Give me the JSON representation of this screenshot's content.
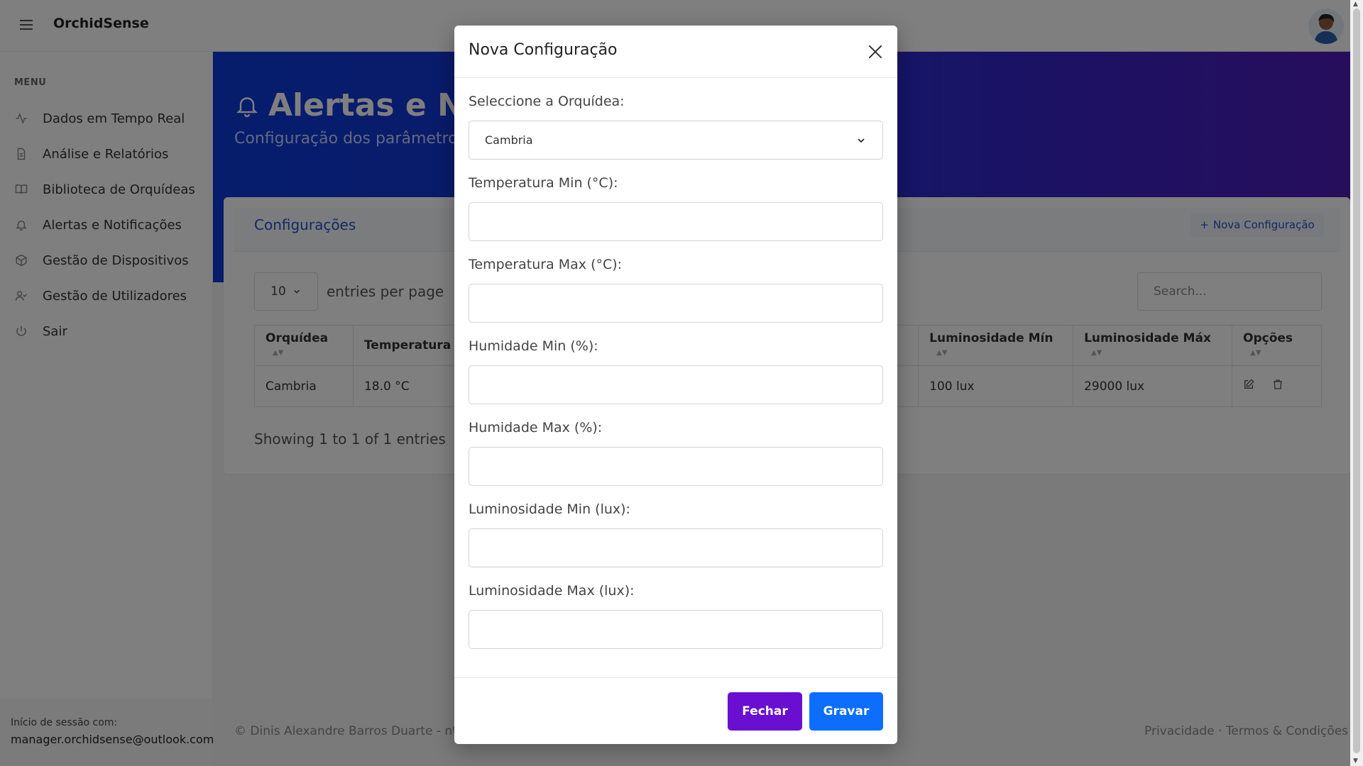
{
  "app": {
    "brand": "OrchidSense"
  },
  "sidebar": {
    "menu_title": "MENU",
    "items": [
      {
        "label": "Dados em Tempo Real",
        "icon": "activity-icon"
      },
      {
        "label": "Análise e Relatórios",
        "icon": "file-text-icon"
      },
      {
        "label": "Biblioteca de Orquídeas",
        "icon": "book-open-icon"
      },
      {
        "label": "Alertas e Notificações",
        "icon": "bell-icon"
      },
      {
        "label": "Gestão de Dispositivos",
        "icon": "box-icon"
      },
      {
        "label": "Gestão de Utilizadores",
        "icon": "user-check-icon"
      },
      {
        "label": "Sair",
        "icon": "power-icon"
      }
    ],
    "session_label": "Início de sessão com:",
    "session_email": "manager.orchidsense@outlook.com"
  },
  "hero": {
    "title": "Alertas e No",
    "subtitle": "Configuração dos parâmetro"
  },
  "card": {
    "title": "Configurações",
    "new_button": "Nova Configuração",
    "per_page_value": "10",
    "per_page_label": "entries per page",
    "search_placeholder": "Search...",
    "columns": [
      "Orquídea",
      "Temperatura M",
      "Luminosidade Mín",
      "Luminosidade Máx",
      "Opções"
    ],
    "row": {
      "orchid": "Cambria",
      "temp": "18.0 °C",
      "lum_min": "100 lux",
      "lum_max": "29000 lux"
    },
    "showing": "Showing 1 to 1 of 1 entries"
  },
  "footer": {
    "left": "© Dinis Alexandre Barros Duarte - nº",
    "right": "Privacidade · Termos & Condições"
  },
  "modal": {
    "title": "Nova Configuração",
    "select_label": "Seleccione a Orquídea:",
    "select_value": "Cambria",
    "fields": [
      {
        "label": "Temperatura Min (°C):",
        "value": ""
      },
      {
        "label": "Temperatura Max (°C):",
        "value": ""
      },
      {
        "label": "Humidade Min (%):",
        "value": ""
      },
      {
        "label": "Humidade Max (%):",
        "value": ""
      },
      {
        "label": "Luminosidade Min (lux):",
        "value": ""
      },
      {
        "label": "Luminosidade Max (lux):",
        "value": ""
      }
    ],
    "close_button": "Fechar",
    "save_button": "Gravar"
  },
  "colors": {
    "hero_start": "#0b3ad8",
    "hero_end": "#4d1cb8",
    "close_btn": "#6a0fd1",
    "save_btn": "#0d6efd",
    "link": "#2454c8"
  }
}
